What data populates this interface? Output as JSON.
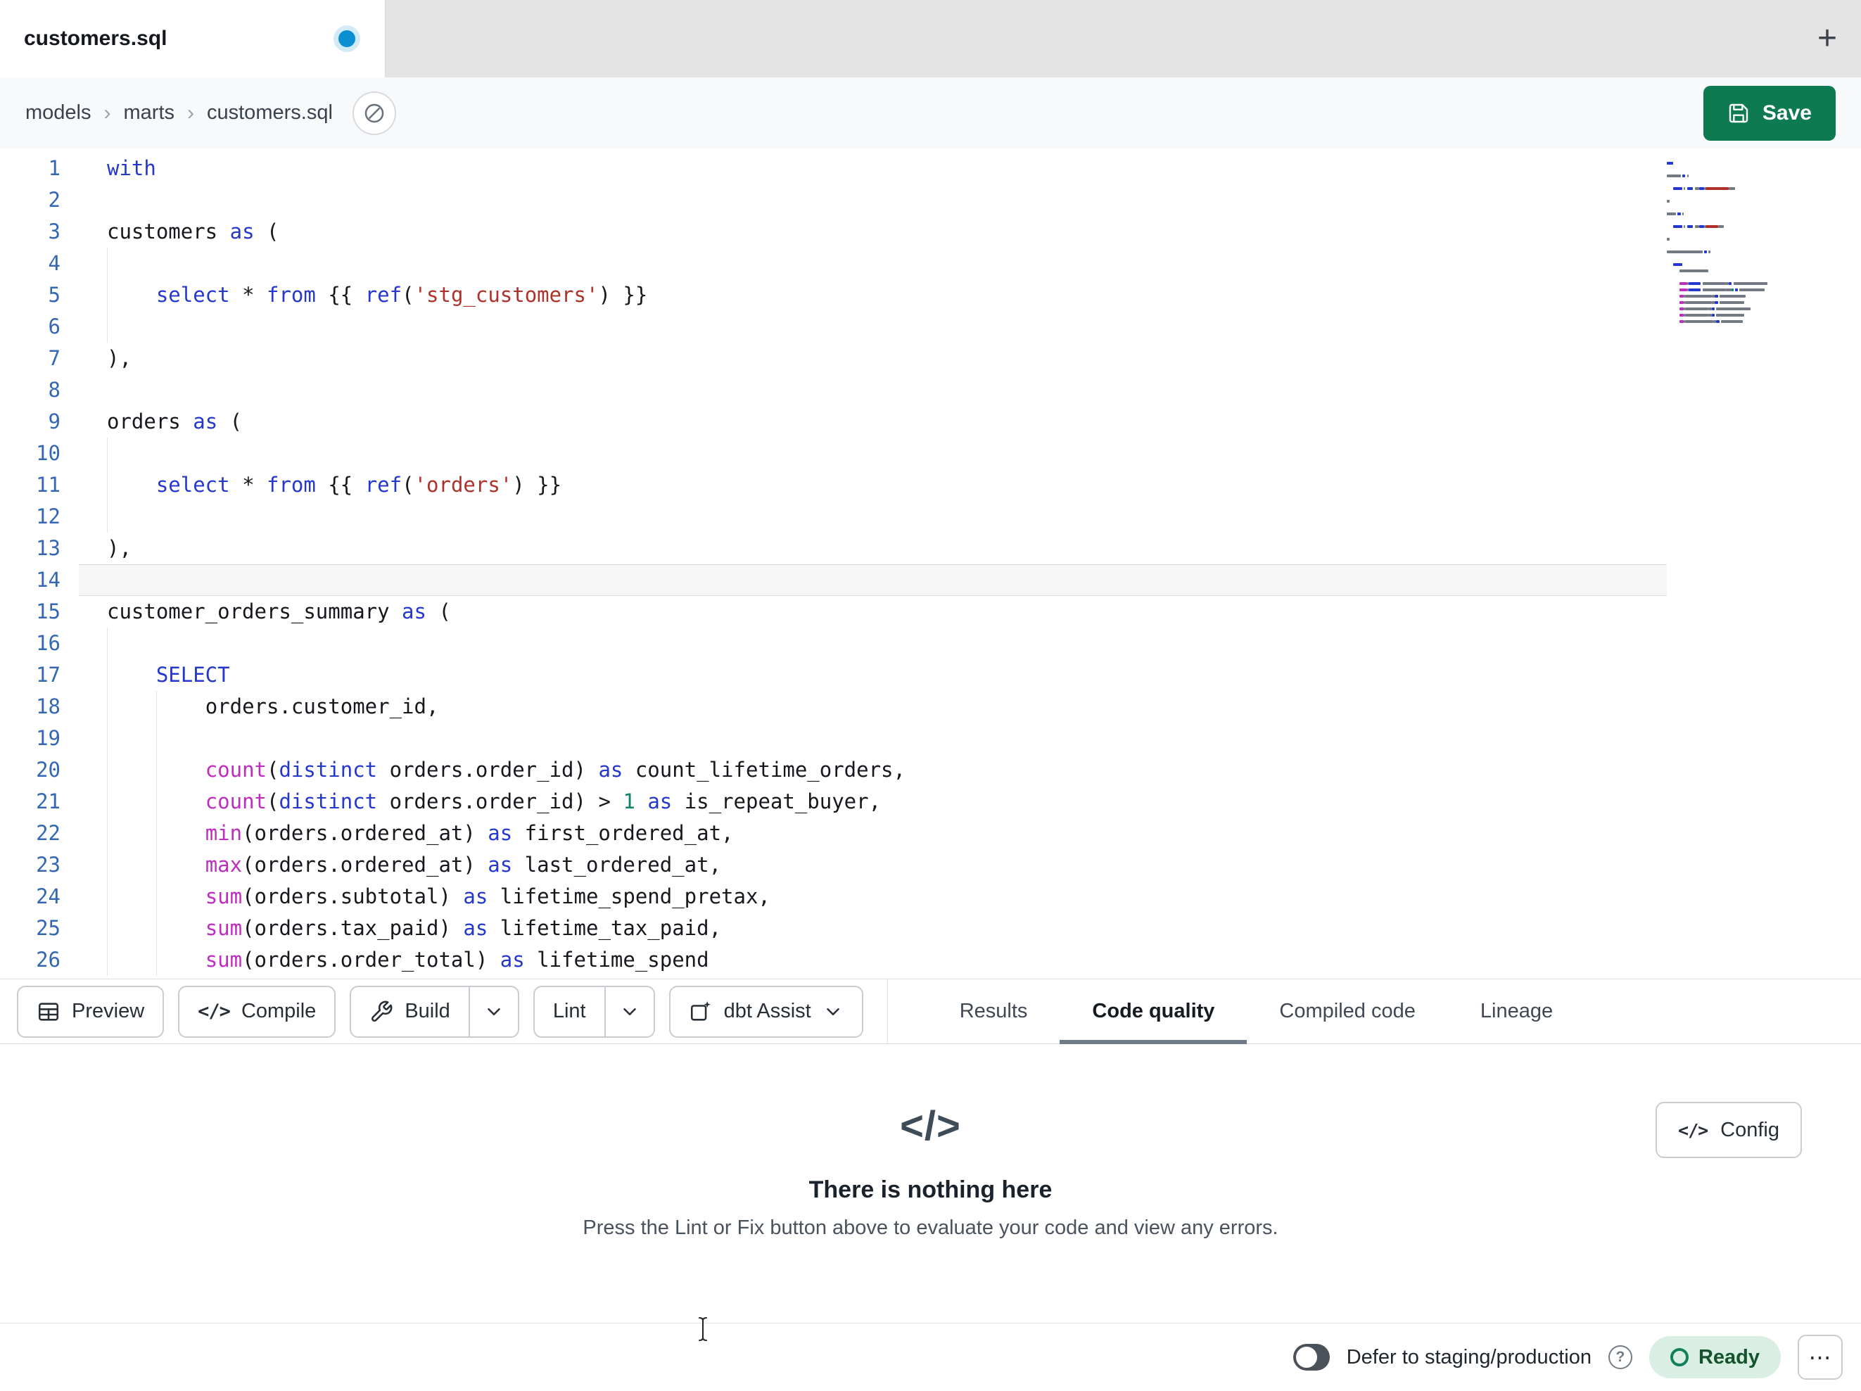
{
  "colors": {
    "accent_green": "#0E7A52",
    "tab_dot_blue": "#0A90D2",
    "line_number": "#3568B4",
    "ready_bg": "#D9EFE3",
    "ready_text": "#14532D",
    "token": {
      "kw": "#2438CE",
      "str": "#AF3129",
      "fn": "#C02BC0",
      "num": "#0E8568",
      "txt": "#16181D"
    }
  },
  "tab_bar": {
    "tabs": [
      {
        "title": "customers.sql",
        "active": true,
        "dirty": true
      }
    ],
    "new_tab": "+"
  },
  "breadcrumb": {
    "items": [
      "models",
      "marts",
      "customers.sql"
    ],
    "separator": "›"
  },
  "save": {
    "label": "Save",
    "icon": "save-icon"
  },
  "editor": {
    "active_line": 14,
    "lines": [
      [
        [
          "with",
          "kw"
        ]
      ],
      [],
      [
        [
          "customers",
          "txt"
        ],
        [
          " ",
          "ws"
        ],
        [
          "as",
          "kw"
        ],
        [
          " ",
          "ws"
        ],
        [
          "(",
          "txt"
        ]
      ],
      [],
      [
        [
          "    ",
          "ws"
        ],
        [
          "select",
          "kw"
        ],
        [
          " ",
          "ws"
        ],
        [
          "*",
          "txt"
        ],
        [
          " ",
          "ws"
        ],
        [
          "from",
          "kw"
        ],
        [
          " ",
          "ws"
        ],
        [
          "{{ ",
          "txt"
        ],
        [
          "ref",
          "kw"
        ],
        [
          "(",
          "txt"
        ],
        [
          "'stg_customers'",
          "str"
        ],
        [
          ") }}",
          "txt"
        ]
      ],
      [],
      [
        [
          "),",
          "txt"
        ]
      ],
      [],
      [
        [
          "orders",
          "txt"
        ],
        [
          " ",
          "ws"
        ],
        [
          "as",
          "kw"
        ],
        [
          " ",
          "ws"
        ],
        [
          "(",
          "txt"
        ]
      ],
      [],
      [
        [
          "    ",
          "ws"
        ],
        [
          "select",
          "kw"
        ],
        [
          " ",
          "ws"
        ],
        [
          "*",
          "txt"
        ],
        [
          " ",
          "ws"
        ],
        [
          "from",
          "kw"
        ],
        [
          " ",
          "ws"
        ],
        [
          "{{ ",
          "txt"
        ],
        [
          "ref",
          "kw"
        ],
        [
          "(",
          "txt"
        ],
        [
          "'orders'",
          "str"
        ],
        [
          ") }}",
          "txt"
        ]
      ],
      [],
      [
        [
          "),",
          "txt"
        ]
      ],
      [],
      [
        [
          "customer_orders_summary",
          "txt"
        ],
        [
          " ",
          "ws"
        ],
        [
          "as",
          "kw"
        ],
        [
          " ",
          "ws"
        ],
        [
          "(",
          "txt"
        ]
      ],
      [],
      [
        [
          "    ",
          "ws"
        ],
        [
          "SELECT",
          "kw"
        ]
      ],
      [
        [
          "        ",
          "ws"
        ],
        [
          "orders.customer_id,",
          "txt"
        ]
      ],
      [],
      [
        [
          "        ",
          "ws"
        ],
        [
          "count",
          "fn"
        ],
        [
          "(",
          "txt"
        ],
        [
          "distinct",
          "kw"
        ],
        [
          " ",
          "ws"
        ],
        [
          "orders.order_id",
          "txt"
        ],
        [
          ") ",
          "txt"
        ],
        [
          "as",
          "kw"
        ],
        [
          " ",
          "ws"
        ],
        [
          "count_lifetime_orders,",
          "txt"
        ]
      ],
      [
        [
          "        ",
          "ws"
        ],
        [
          "count",
          "fn"
        ],
        [
          "(",
          "txt"
        ],
        [
          "distinct",
          "kw"
        ],
        [
          " ",
          "ws"
        ],
        [
          "orders.order_id",
          "txt"
        ],
        [
          ") > ",
          "txt"
        ],
        [
          "1",
          "num"
        ],
        [
          " ",
          "ws"
        ],
        [
          "as",
          "kw"
        ],
        [
          " ",
          "ws"
        ],
        [
          "is_repeat_buyer,",
          "txt"
        ]
      ],
      [
        [
          "        ",
          "ws"
        ],
        [
          "min",
          "fn"
        ],
        [
          "(",
          "txt"
        ],
        [
          "orders.ordered_at",
          "txt"
        ],
        [
          ") ",
          "txt"
        ],
        [
          "as",
          "kw"
        ],
        [
          " ",
          "ws"
        ],
        [
          "first_ordered_at,",
          "txt"
        ]
      ],
      [
        [
          "        ",
          "ws"
        ],
        [
          "max",
          "fn"
        ],
        [
          "(",
          "txt"
        ],
        [
          "orders.ordered_at",
          "txt"
        ],
        [
          ") ",
          "txt"
        ],
        [
          "as",
          "kw"
        ],
        [
          " ",
          "ws"
        ],
        [
          "last_ordered_at,",
          "txt"
        ]
      ],
      [
        [
          "        ",
          "ws"
        ],
        [
          "sum",
          "fn"
        ],
        [
          "(",
          "txt"
        ],
        [
          "orders.subtotal",
          "txt"
        ],
        [
          ") ",
          "txt"
        ],
        [
          "as",
          "kw"
        ],
        [
          " ",
          "ws"
        ],
        [
          "lifetime_spend_pretax,",
          "txt"
        ]
      ],
      [
        [
          "        ",
          "ws"
        ],
        [
          "sum",
          "fn"
        ],
        [
          "(",
          "txt"
        ],
        [
          "orders.tax_paid",
          "txt"
        ],
        [
          ") ",
          "txt"
        ],
        [
          "as",
          "kw"
        ],
        [
          " ",
          "ws"
        ],
        [
          "lifetime_tax_paid,",
          "txt"
        ]
      ],
      [
        [
          "        ",
          "ws"
        ],
        [
          "sum",
          "fn"
        ],
        [
          "(",
          "txt"
        ],
        [
          "orders.order_total",
          "txt"
        ],
        [
          ") ",
          "txt"
        ],
        [
          "as",
          "kw"
        ],
        [
          " ",
          "ws"
        ],
        [
          "lifetime_spend",
          "txt"
        ]
      ]
    ]
  },
  "toolbar": {
    "buttons": [
      {
        "name": "preview",
        "label": "Preview",
        "icon": "table-icon"
      },
      {
        "name": "compile",
        "label": "Compile",
        "icon": "code-icon"
      },
      {
        "name": "build",
        "label": "Build",
        "icon": "build-icon",
        "split_chevron": true
      },
      {
        "name": "lint",
        "label": "Lint",
        "split_chevron": true
      },
      {
        "name": "dbt-assist",
        "label": "dbt Assist",
        "icon": "assist-icon",
        "chevron": true
      }
    ],
    "tabs": [
      {
        "label": "Results",
        "active": false
      },
      {
        "label": "Code quality",
        "active": true
      },
      {
        "label": "Compiled code",
        "active": false
      },
      {
        "label": "Lineage",
        "active": false
      }
    ]
  },
  "results_panel": {
    "icon": "code-icon",
    "title": "There is nothing here",
    "message": "Press the Lint or Fix button above to evaluate your code and view any errors.",
    "config_button": {
      "label": "Config",
      "icon": "code-icon"
    }
  },
  "status_bar": {
    "defer_toggle": {
      "on": false
    },
    "defer_label": "Defer to staging/production",
    "help_icon": "?",
    "ready": {
      "label": "Ready"
    },
    "more": "⋯"
  }
}
